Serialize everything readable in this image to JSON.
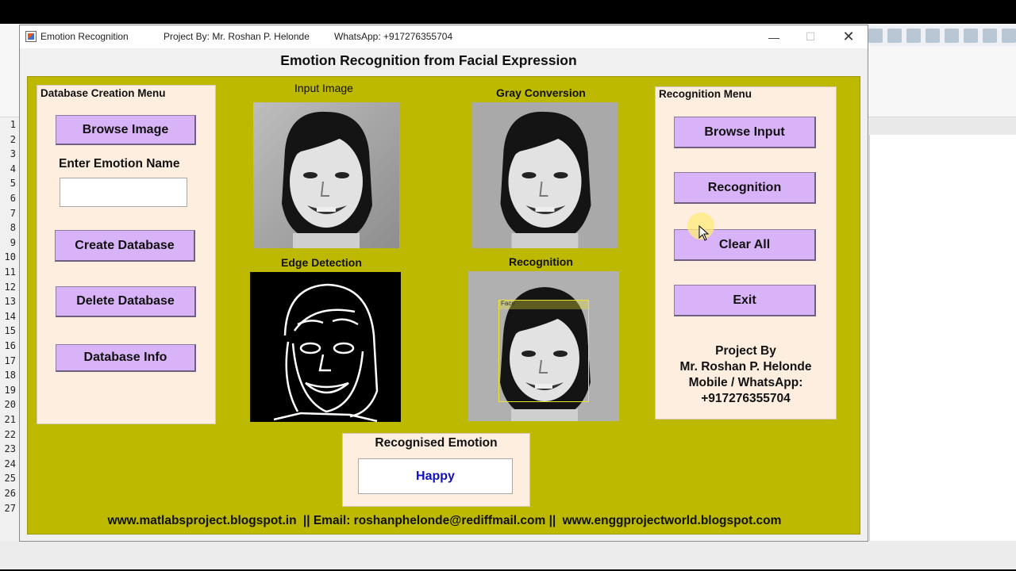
{
  "window": {
    "app_name": "Emotion Recognition",
    "project_by": "Project By: Mr. Roshan P. Helonde",
    "whatsapp": "WhatsApp: +917276355704"
  },
  "figure": {
    "title": "Emotion Recognition from Facial Expression"
  },
  "database_menu": {
    "title": "Database Creation Menu",
    "browse_image": "Browse Image",
    "emotion_name_label": "Enter Emotion Name",
    "emotion_name_value": "",
    "create_database": "Create Database",
    "delete_database": "Delete Database",
    "database_info": "Database Info"
  },
  "images": {
    "input_label": "Input Image",
    "gray_label": "Gray Conversion",
    "edge_label": "Edge Detection",
    "recognition_label": "Recognition",
    "face_box_label": "Face"
  },
  "result": {
    "title": "Recognised Emotion",
    "value": "Happy",
    "value_color": "#1010c0"
  },
  "recognition_menu": {
    "title": "Recognition Menu",
    "browse_input": "Browse Input",
    "recognition": "Recognition",
    "clear_all": "Clear All",
    "exit": "Exit"
  },
  "credit": {
    "line1": "Project By",
    "line2": "Mr. Roshan P. Helonde",
    "line3": "Mobile / WhatsApp:",
    "line4": "+917276355704"
  },
  "footer": {
    "site1": "www.matlabsproject.blogspot.in",
    "email": "|| Email: roshanphelonde@rediffmail.com ||",
    "site2": "www.enggprojectworld.blogspot.com"
  },
  "colors": {
    "panel_bg": "#bdb800",
    "menu_bg": "#fdeee0",
    "button_bg": "#d9b3f7"
  },
  "editor": {
    "line_numbers": [
      "1",
      "2",
      "3",
      "4",
      "5",
      "6",
      "7",
      "8",
      "9",
      "10",
      "11",
      "12",
      "13",
      "14",
      "15",
      "16",
      "17",
      "18",
      "19",
      "20",
      "21",
      "22",
      "23",
      "24",
      "25",
      "26",
      "27"
    ]
  }
}
